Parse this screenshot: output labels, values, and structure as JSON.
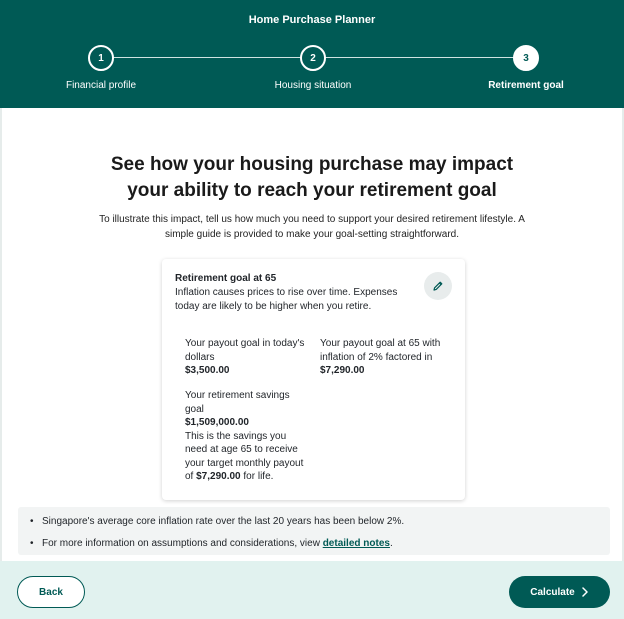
{
  "header": {
    "title": "Home Purchase Planner",
    "steps": [
      {
        "number": "1",
        "label": "Financial profile",
        "state": "done"
      },
      {
        "number": "2",
        "label": "Housing situation",
        "state": "done"
      },
      {
        "number": "3",
        "label": "Retirement goal",
        "state": "active"
      }
    ]
  },
  "main": {
    "headline_line1": "See how your housing purchase may impact",
    "headline_line2": "your ability to reach your retirement goal",
    "intro": "To illustrate this impact, tell us how much you need to support your desired retirement lifestyle. A simple guide is provided to make your goal-setting straightforward."
  },
  "card": {
    "title": "Retirement goal at 65",
    "description": "Inflation causes prices to rise over time. Expenses today are likely to be higher when you retire.",
    "edit_icon": "pencil-icon",
    "payout_today_label": "Your payout goal in today's dollars",
    "payout_today_value": "$3,500.00",
    "payout_65_label": "Your payout goal at 65 with inflation of 2% factored in",
    "payout_65_value": "$7,290.00",
    "savings_label": "Your retirement savings goal",
    "savings_value": "$1,509,000.00",
    "savings_note_prefix": "This is the savings you need at age 65 to receive your target monthly payout of",
    "savings_note_amount": "$7,290.00",
    "savings_note_suffix": "for life."
  },
  "notes": {
    "item1": "Singapore's average core inflation rate over the last 20 years has been below 2%.",
    "item2_prefix": "For more information on assumptions and considerations, view",
    "item2_link": "detailed notes",
    "item2_suffix": "."
  },
  "footer": {
    "back_label": "Back",
    "calculate_label": "Calculate",
    "calculate_icon": "chevron-right-icon"
  },
  "colors": {
    "brand": "#005a55",
    "footer_bg": "#e1f2ef",
    "notes_bg": "#f2f4f4"
  }
}
